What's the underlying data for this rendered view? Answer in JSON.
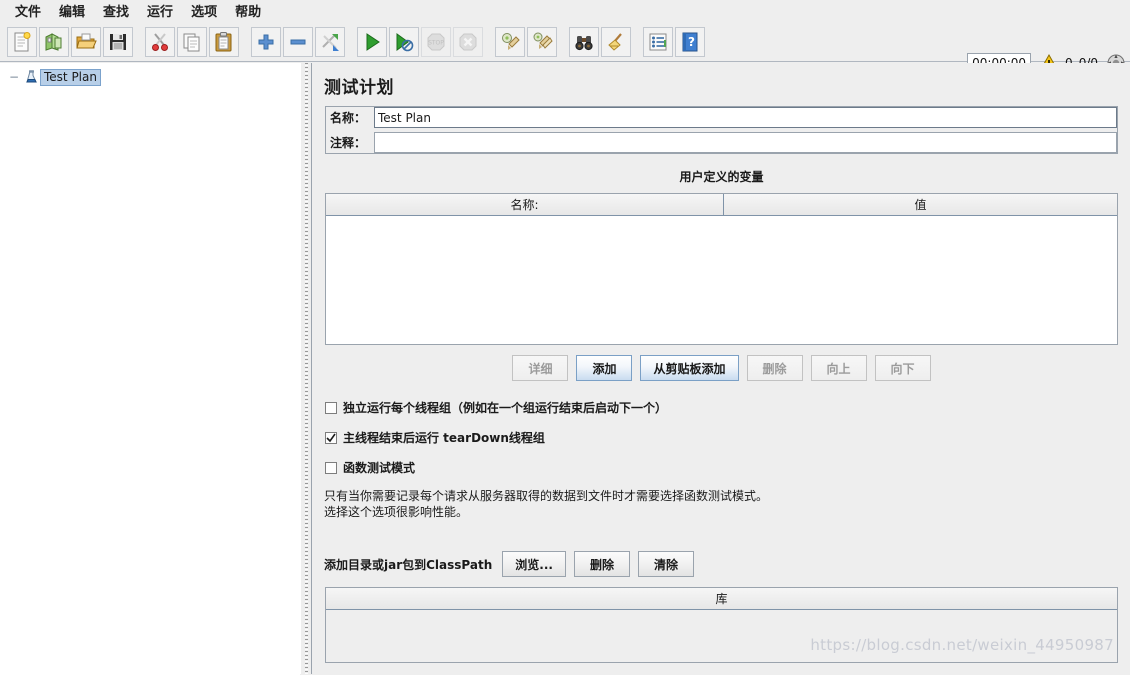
{
  "menubar": {
    "items": [
      {
        "label": "文件",
        "name": "menu-file"
      },
      {
        "label": "编辑",
        "name": "menu-edit"
      },
      {
        "label": "查找",
        "name": "menu-search"
      },
      {
        "label": "运行",
        "name": "menu-run"
      },
      {
        "label": "选项",
        "name": "menu-options"
      },
      {
        "label": "帮助",
        "name": "menu-help"
      }
    ]
  },
  "toolbar": {
    "icons": [
      "new-document-icon",
      "templates-icon",
      "open-folder-icon",
      "save-icon",
      "cut-scissors-icon",
      "copy-icon",
      "paste-icon",
      "expand-plus-icon",
      "collapse-minus-icon",
      "toggle-icon",
      "start-play-icon",
      "start-no-pauses-icon",
      "stop-icon",
      "shutdown-icon",
      "clear-icon",
      "clear-all-icon",
      "search-binoculars-icon",
      "reset-search-broom-icon",
      "log-viewer-icon",
      "help-icon"
    ],
    "status": {
      "timer": "00:00:00",
      "warning_icon": "warning-triangle-icon",
      "warning_count": "0",
      "thread_count": "0/0",
      "connection_icon": "remote-engines-icon"
    }
  },
  "tree": {
    "root": {
      "label": "Test Plan",
      "icon": "test-plan-flask-icon",
      "selected": true,
      "expander": "−"
    }
  },
  "main": {
    "title": "测试计划",
    "name_label": "名称：",
    "name_value": "Test Plan",
    "comment_label": "注释：",
    "comment_value": "",
    "comment_placeholder": "",
    "variables": {
      "heading": "用户定义的变量",
      "columns": [
        "名称:",
        "值"
      ],
      "rows": []
    },
    "variable_buttons": [
      {
        "label": "详细",
        "name": "detail-button",
        "state": "disabled"
      },
      {
        "label": "添加",
        "name": "add-button",
        "state": "primary"
      },
      {
        "label": "从剪贴板添加",
        "name": "add-from-clipboard-button",
        "state": "primary"
      },
      {
        "label": "删除",
        "name": "delete-button",
        "state": "disabled"
      },
      {
        "label": "向上",
        "name": "move-up-button",
        "state": "disabled"
      },
      {
        "label": "向下",
        "name": "move-down-button",
        "state": "disabled"
      }
    ],
    "checkboxes": [
      {
        "label": "独立运行每个线程组（例如在一个组运行结束后启动下一个）",
        "name": "run-thread-groups-consecutively-checkbox",
        "checked": false
      },
      {
        "label": "主线程结束后运行 tearDown线程组",
        "name": "run-teardown-after-shutdown-checkbox",
        "checked": true
      },
      {
        "label": "函数测试模式",
        "name": "functional-test-mode-checkbox",
        "checked": false
      }
    ],
    "help_line1": "只有当你需要记录每个请求从服务器取得的数据到文件时才需要选择函数测试模式。",
    "help_line2": "选择这个选项很影响性能。",
    "classpath": {
      "label": "添加目录或jar包到ClassPath",
      "buttons": [
        {
          "label": "浏览...",
          "name": "browse-button"
        },
        {
          "label": "删除",
          "name": "classpath-delete-button"
        },
        {
          "label": "清除",
          "name": "classpath-clear-button"
        }
      ],
      "table_header": "库",
      "rows": []
    }
  },
  "watermark": "https://blog.csdn.net/weixin_44950987",
  "colors": {
    "window_bg": "#eeeeee",
    "panel_bg": "#ffffff",
    "selection_blue": "#b8cfe8",
    "border": "#9aa3ad",
    "accent_blue": "#3a6ea5",
    "warning_yellow": "#f5c518",
    "start_green": "#2f9e2f"
  }
}
